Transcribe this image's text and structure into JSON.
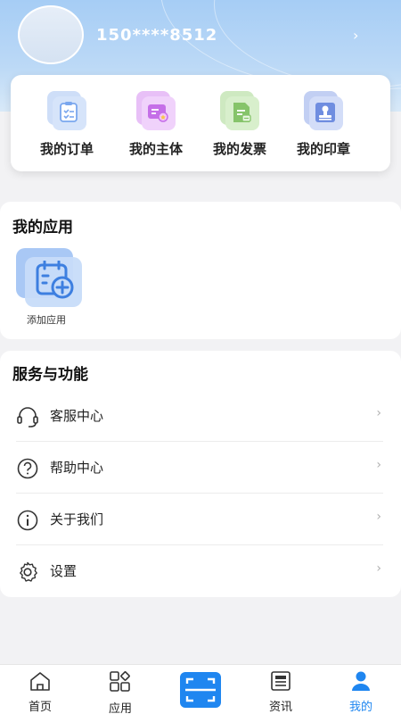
{
  "profile": {
    "phone": "150****8512"
  },
  "shortcuts": [
    {
      "label": "我的订单",
      "icon": "order-clipboard-icon",
      "color": "#7aa7ee"
    },
    {
      "label": "我的主体",
      "icon": "entity-badge-icon",
      "color": "#c56fe8"
    },
    {
      "label": "我的发票",
      "icon": "invoice-icon",
      "color": "#86c46a"
    },
    {
      "label": "我的印章",
      "icon": "seal-stamp-icon",
      "color": "#6f8de0"
    }
  ],
  "apps": {
    "title": "我的应用",
    "add_label": "添加应用"
  },
  "services": {
    "title": "服务与功能",
    "items": [
      {
        "label": "客服中心",
        "icon": "headset-icon"
      },
      {
        "label": "帮助中心",
        "icon": "question-circle-icon"
      },
      {
        "label": "关于我们",
        "icon": "info-circle-icon"
      },
      {
        "label": "设置",
        "icon": "gear-icon"
      }
    ]
  },
  "tabbar": {
    "items": [
      {
        "label": "首页",
        "icon": "home-icon"
      },
      {
        "label": "应用",
        "icon": "apps-grid-icon"
      },
      {
        "label": "",
        "icon": "scan-icon"
      },
      {
        "label": "资讯",
        "icon": "news-icon"
      },
      {
        "label": "我的",
        "icon": "user-icon"
      }
    ],
    "active_color": "#1f86f0"
  }
}
